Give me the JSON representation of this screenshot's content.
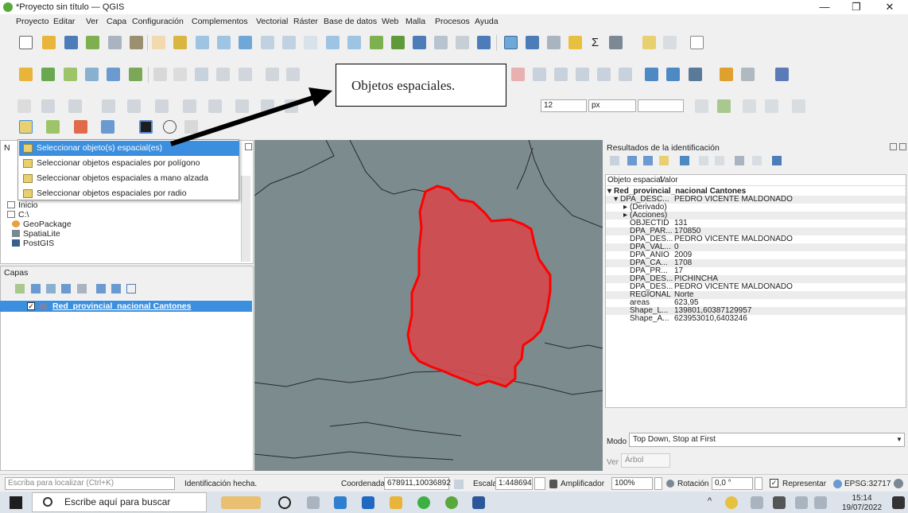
{
  "window": {
    "title": "*Proyecto sin título — QGIS",
    "minimize_glyph": "—",
    "restore_glyph": "❐",
    "close_glyph": "✕"
  },
  "menu": [
    "Proyecto",
    "Editar",
    "Ver",
    "Capa",
    "Configuración",
    "Complementos",
    "Vectorial",
    "Ráster",
    "Base de datos",
    "Web",
    "Malla",
    "Procesos",
    "Ayuda"
  ],
  "toolbar": {
    "font_size_value": "12",
    "unit_value": "px"
  },
  "callout": {
    "text": "Objetos espaciales."
  },
  "select_menu": {
    "items": [
      "Seleccionar objeto(s) espacial(es)",
      "Seleccionar objetos espaciales por polígono",
      "Seleccionar objetos espaciales a mano alzada",
      "Seleccionar objetos espaciales por radio"
    ]
  },
  "browser": {
    "items": [
      "Inicio",
      "C:\\",
      "GeoPackage",
      "SpatiaLite",
      "PostGIS"
    ]
  },
  "layers_panel": {
    "title": "Capas",
    "layer_name": "Red_provincial_nacional Cantones"
  },
  "identify": {
    "title": "Resultados de la identificación",
    "col_feature": "Objeto espacial",
    "col_value": "Valor",
    "layer": "Red_provincial_nacional Cantones",
    "root_key": "DPA_DESC...",
    "root_value": "PEDRO VICENTE MALDONADO",
    "derived": "(Derivado)",
    "actions": "(Acciones)",
    "attributes": [
      {
        "key": "OBJECTID",
        "value": "131"
      },
      {
        "key": "DPA_PAR...",
        "value": "170850"
      },
      {
        "key": "DPA_DES...",
        "value": "PEDRO VICENTE MALDONADO"
      },
      {
        "key": "DPA_VAL...",
        "value": "0"
      },
      {
        "key": "DPA_ANIO",
        "value": "2009"
      },
      {
        "key": "DPA_CA...",
        "value": "1708"
      },
      {
        "key": "DPA_PR...",
        "value": "17"
      },
      {
        "key": "DPA_DES...",
        "value": "PICHINCHA"
      },
      {
        "key": "DPA_DES...",
        "value": "PEDRO VICENTE MALDONADO"
      },
      {
        "key": "REGIONAL",
        "value": "Norte"
      },
      {
        "key": "areas",
        "value": "623,95"
      },
      {
        "key": "Shape_L...",
        "value": "139801,60387129957"
      },
      {
        "key": "Shape_A...",
        "value": "623953010,6403246"
      }
    ],
    "mode_label": "Modo",
    "mode_value": "Top Down, Stop at First",
    "view_label": "Ver",
    "view_value": "Árbol"
  },
  "status": {
    "search_placeholder": "Escriba para localizar (Ctrl+K)",
    "message": "Identificación hecha.",
    "coord_label": "Coordenada",
    "coord_value": "678911,10036892",
    "scale_label": "Escala",
    "scale_value": "1:448694",
    "magnifier_label": "Amplificador",
    "magnifier_value": "100%",
    "rotation_label": "Rotación",
    "rotation_value": "0,0 °",
    "render_label": "Representar",
    "crs": "EPSG:32717"
  },
  "taskbar": {
    "search_text": "Escribe aquí para buscar",
    "time": "15:14",
    "date": "19/07/2022"
  },
  "colors": {
    "selection_blue": "#3b8fde",
    "polygon_fill": "#d24a4f",
    "polygon_stroke": "#ff0000",
    "map_bg": "#7b8b8e"
  }
}
